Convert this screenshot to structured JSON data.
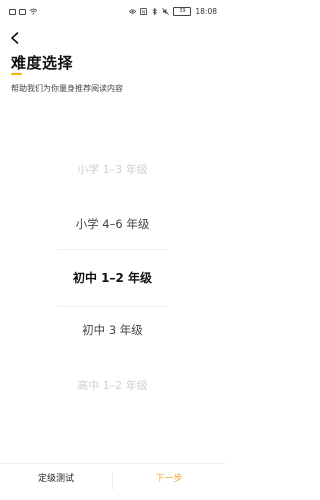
{
  "status_bar": {
    "battery": "39",
    "time": "18:08",
    "icons": [
      "notification-icon",
      "notification-icon",
      "wifi-icon",
      "eye-icon",
      "nfc-icon",
      "bluetooth-icon",
      "mute-icon",
      "battery-icon"
    ]
  },
  "header": {
    "back_icon": "chevron-left-icon",
    "title": "难度选择",
    "subtitle": "帮助我们为你量身推荐阅读内容",
    "accent_color": "#f5b400"
  },
  "picker": {
    "selected_index": 2,
    "options": [
      "小学 1–3 年级",
      "小学 4–6 年级",
      "初中 1–2 年级",
      "初中 3 年级",
      "高中 1–2 年级"
    ]
  },
  "footer": {
    "placement_test_label": "定级测试",
    "next_step_label": "下一步",
    "next_color": "#f5a623"
  }
}
